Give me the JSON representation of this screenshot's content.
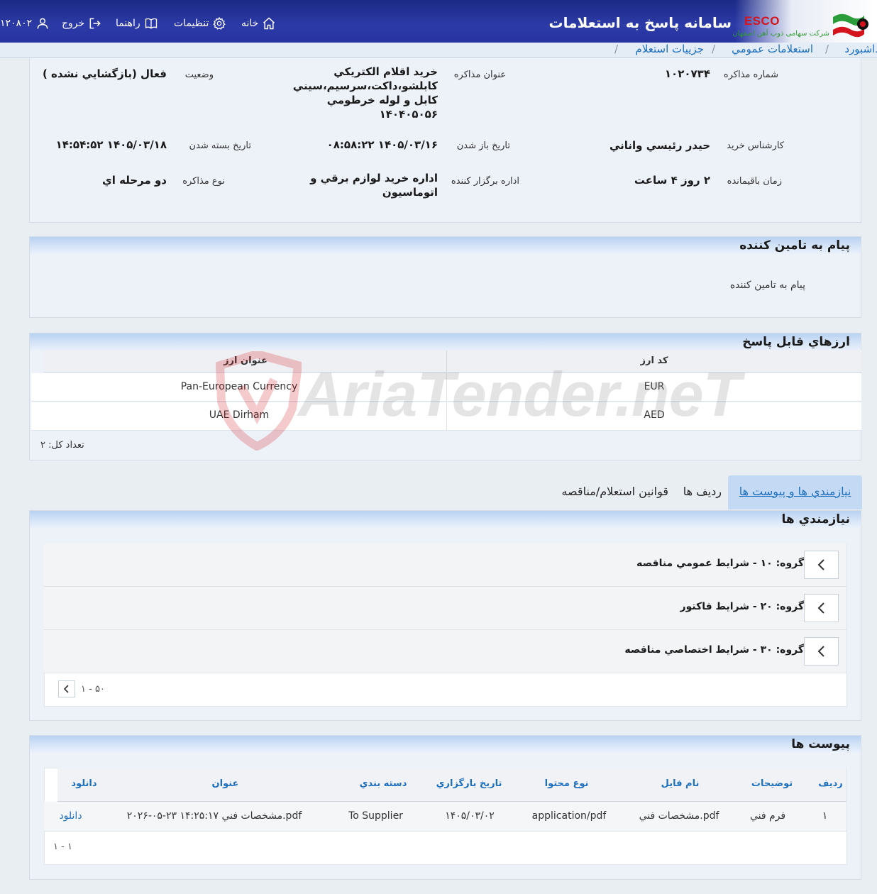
{
  "header": {
    "app_title": "سامانه پاسخ به استعلامات",
    "brand": "ESCO",
    "brand_subtitle": "شرکت سهامی ذوب آهن اصفهان",
    "nav": {
      "home": "خانه",
      "settings": "تنظیمات",
      "help": "راهنما",
      "logout": "خروج",
      "user": "۱۲۰۸۰۲"
    }
  },
  "breadcrumb": {
    "dashboard": "داشبورد",
    "public_inquiries": "استعلامات عمومي",
    "inquiry_details": "جزييات استعلام",
    "sep": "/"
  },
  "details": {
    "negotiation_number_label": "شماره مذاکره",
    "negotiation_number": "۱۰۲۰۷۳۴",
    "negotiation_title_label": "عنوان مذاکره",
    "negotiation_title_lines": [
      "خريد اقلام الكتريكي",
      "کابلشو،داکت،سرسيم،سيني",
      "کابل و لوله خرطومي",
      "۱۴۰۴۰۵۰۵۶"
    ],
    "status_label": "وضعيت",
    "status": "فعال (بازگشايي نشده )",
    "buyer_label": "کارشناس خريد",
    "buyer": "حيدر رئيسي واناني",
    "open_date_label": "تاريخ باز شدن",
    "open_date": "۱۴۰۵/۰۳/۱۶ ۰۸:۵۸:۲۲",
    "close_date_label": "تاريخ بسته شدن",
    "close_date": "۱۴۰۵/۰۳/۱۸ ۱۴:۵۴:۵۲",
    "remaining_label": "زمان باقيمانده",
    "remaining": "۲ روز ۴ ساعت",
    "organizer_label": "اداره برگزار کننده",
    "organizer_lines": [
      "اداره خريد لوازم برقي و",
      "اتوماسيون"
    ],
    "type_label": "نوع مذاکره",
    "type": "دو مرحله اي"
  },
  "supplier_message": {
    "title": "پيام به تامين کننده",
    "text": "پيام به تامين کننده"
  },
  "currencies": {
    "title": "ارزهاي قابل پاسخ",
    "col_code": "کد ارز",
    "col_title": "عنوان ارز",
    "rows": [
      {
        "code": "EUR",
        "title": "Pan-European Currency"
      },
      {
        "code": "AED",
        "title": "UAE Dirham"
      }
    ],
    "total": "تعداد کل: ۲"
  },
  "tabs": {
    "needs": "نيازمندي ها و پيوست ها",
    "rows": "رديف ها",
    "rules": "قوانين استعلام/مناقصه"
  },
  "needs": {
    "title": "نيازمندي ها",
    "groups": [
      {
        "label": "گروه: ۱۰ - شرايط عمومي مناقصه"
      },
      {
        "label": "گروه: ۲۰ - شرايط فاکتور"
      },
      {
        "label": "گروه: ۳۰ - شرايط اختصاصي مناقصه"
      }
    ],
    "pager": "۱ - ۵۰"
  },
  "attachments": {
    "title": "پيوست ها",
    "columns": {
      "row": "رديف",
      "description": "توضيحات",
      "file_name": "نام فايل",
      "content_type": "نوع محتوا",
      "upload_date": "تاريخ بارگزاري",
      "category": "دسته بندي",
      "title": "عنوان",
      "download": "دانلود"
    },
    "rows": [
      {
        "row": "۱",
        "description": "فرم فني",
        "file_name": "مشخصات فني.pdf",
        "content_type": "application/pdf",
        "upload_date": "۱۴۰۵/۰۳/۰۲",
        "category": "To Supplier",
        "title": "۲۰۲۶-۰۵-۲۳ ۱۴:۲۵:۱۷ مشخصات فني.pdf",
        "download": "دانلود"
      }
    ],
    "pager": "۱ - ۱"
  },
  "watermark": "AriaTender.neT",
  "colors": {
    "header_bg": "#2633a0",
    "link": "#1d6fbf",
    "panel_bg": "#edf2f9",
    "brand_red": "#d4131c"
  }
}
